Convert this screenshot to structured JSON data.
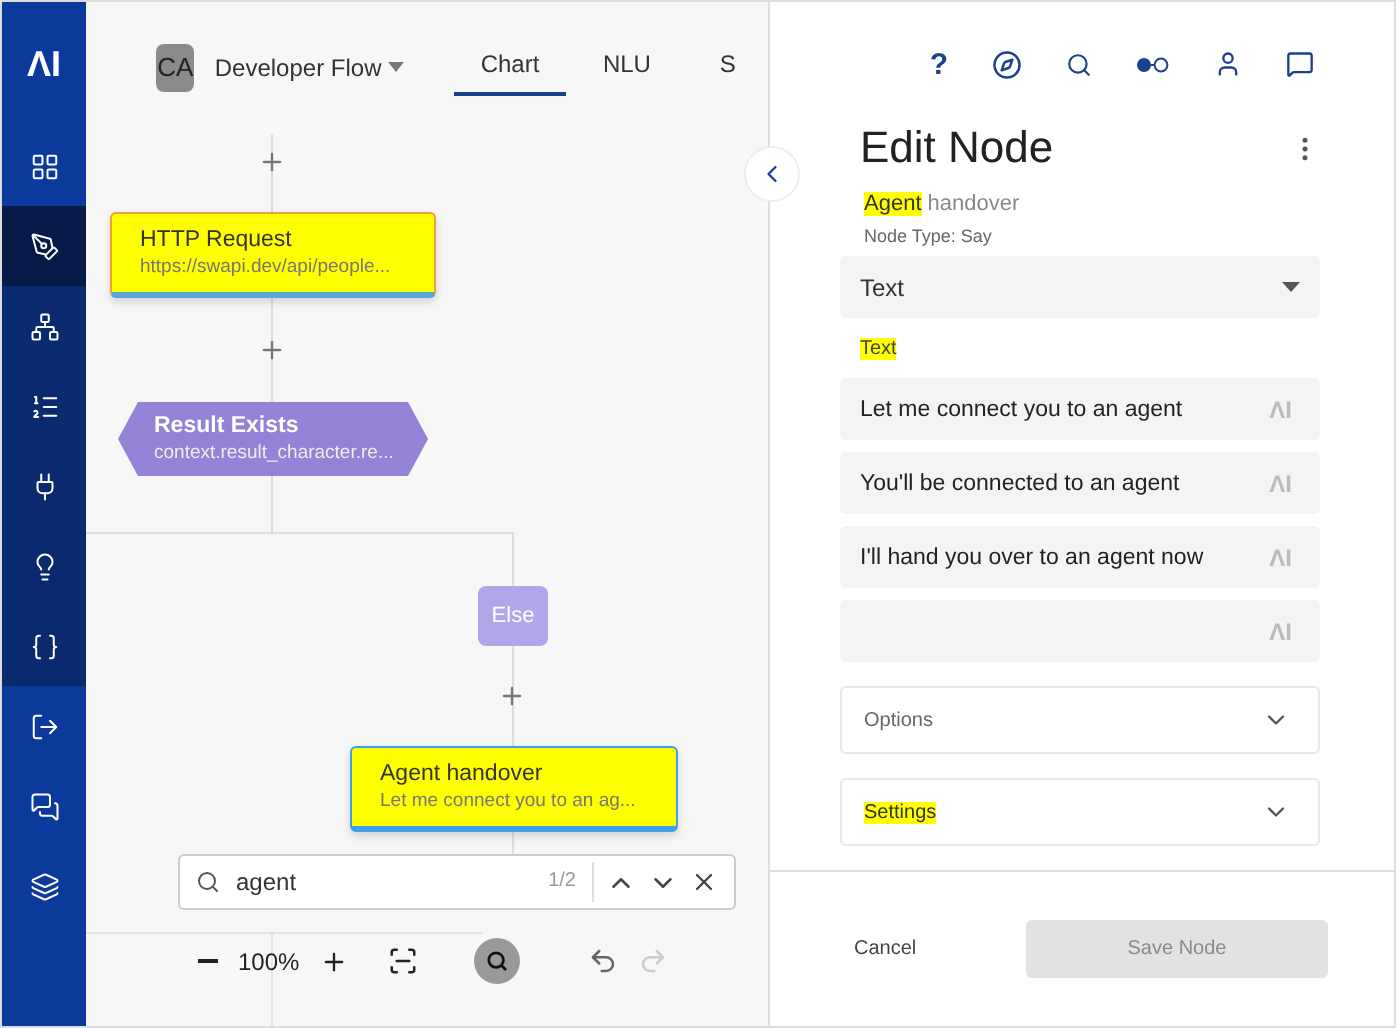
{
  "sidebar": {
    "logo": "ΛI",
    "sections": [
      {
        "kind": "primary",
        "items": [
          {
            "kind": "grid",
            "selected": false
          }
        ]
      },
      {
        "kind": "dark",
        "items": [
          {
            "kind": "pen",
            "selected": true
          },
          {
            "kind": "hierarchy",
            "selected": false
          },
          {
            "kind": "list",
            "selected": false
          },
          {
            "kind": "plug",
            "selected": false
          },
          {
            "kind": "bulb",
            "selected": false
          },
          {
            "kind": "braces",
            "selected": false
          }
        ]
      },
      {
        "kind": "primary",
        "items": [
          {
            "kind": "exit",
            "selected": false
          },
          {
            "kind": "chat",
            "selected": false
          },
          {
            "kind": "layers",
            "selected": false
          }
        ]
      }
    ]
  },
  "header": {
    "avatar": "CA",
    "flow_name": "Developer Flow",
    "tabs": [
      {
        "label": "Chart",
        "selected": true
      },
      {
        "label": "NLU",
        "selected": false
      },
      {
        "label": "S",
        "selected": false
      }
    ]
  },
  "canvas": {
    "nodes": [
      {
        "kind": "action",
        "title": "HTTP Request",
        "subtitle": "https://swapi.dev/api/people...",
        "highlighted": true,
        "selected": false
      },
      {
        "kind": "condition",
        "title": "Result Exists",
        "subtitle": "context.result_character.re...",
        "highlighted": false,
        "selected": false
      },
      {
        "kind": "branch",
        "title": "Else",
        "highlighted": false,
        "selected": false
      },
      {
        "kind": "action",
        "title": "Agent handover",
        "subtitle": "Let me connect you to an ag...",
        "highlighted": true,
        "selected": true
      }
    ]
  },
  "search": {
    "value": "agent",
    "count": "1/2"
  },
  "zoom": {
    "level_text": "100%"
  },
  "panel": {
    "help_label": "?",
    "title": "Edit Node",
    "node_name": [
      {
        "text": "Agent",
        "highlighted": true
      },
      {
        "text": " handover",
        "highlighted": false
      }
    ],
    "node_type": "Node Type: Say",
    "type_select": "Text",
    "text_label": {
      "text": "Text",
      "highlighted": true
    },
    "responses": [
      {
        "text": "Let me connect you to an agent",
        "badge": "ΛI"
      },
      {
        "text": "You'll be connected to an agent",
        "badge": "ΛI"
      },
      {
        "text": "I'll hand you over to an agent now",
        "badge": "ΛI"
      },
      {
        "badge": "ΛI"
      }
    ],
    "accordions": [
      {
        "label": "Options",
        "highlighted": false,
        "expanded": false
      },
      {
        "label": "Settings",
        "highlighted": true,
        "expanded": false
      }
    ],
    "cancel": "Cancel",
    "save": {
      "label": "Save Node",
      "disabled": true
    }
  }
}
